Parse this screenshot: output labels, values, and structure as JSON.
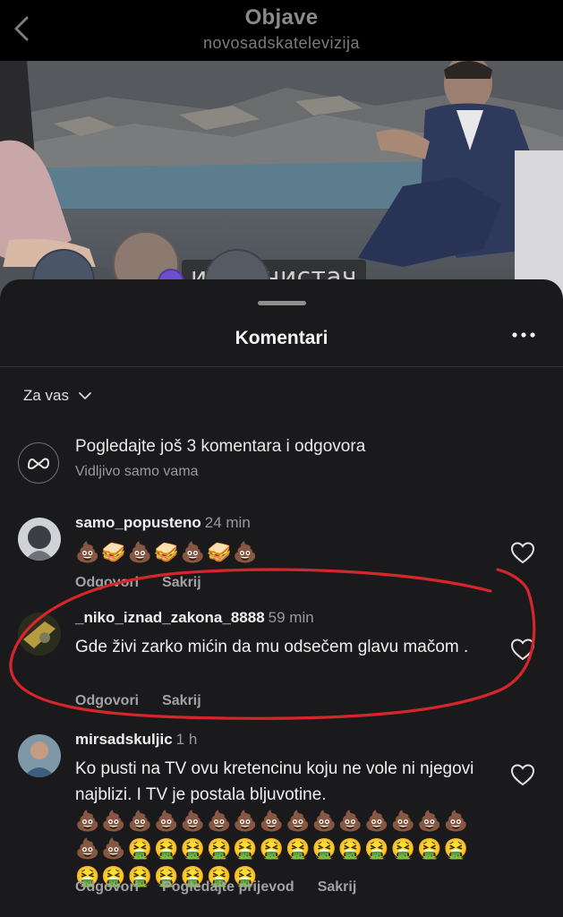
{
  "header": {
    "title": "Objave",
    "subtitle": "novosadskatelevizija"
  },
  "video": {
    "caption": "и пречистач"
  },
  "sheet": {
    "title": "Komentari",
    "filter_label": "Za vas",
    "meta_notice": {
      "title": "Pogledajte još 3 komentara i odgovora",
      "subtitle": "Vidljivo samo vama"
    }
  },
  "comments": [
    {
      "username": "samo_popusteno",
      "time": "24 min",
      "text": "💩🥪💩🥪💩🥪💩",
      "actions": [
        "Odgovori",
        "Sakrij"
      ]
    },
    {
      "username": "_niko_iznad_zakona_8888",
      "time": "59 min",
      "text": "Gde živi zarko mićin da mu odsečem glavu mačom .",
      "actions": [
        "Odgovori",
        "Sakrij"
      ]
    },
    {
      "username": "mirsadskuljic",
      "time": "1 h",
      "text": "Ko pusti na TV ovu kretencinu koju ne vole ni njegovi najblizi. I TV je postala bljuvotine.",
      "emojis": "💩💩💩💩💩💩💩💩💩💩💩💩💩💩💩💩💩🤮🤮🤮🤮🤮🤮🤮🤮🤮🤮🤮🤮🤮🤮🤮🤮🤮🤮🤮🤮",
      "actions": [
        "Odgovori",
        "Pogledajte prijevod",
        "Sakrij"
      ]
    }
  ],
  "icons": {
    "back": "chevron-left-icon",
    "more": "more-horizontal-icon",
    "filter": "chevron-down-icon",
    "meta": "meta-logo-icon",
    "like": "heart-icon"
  },
  "colors": {
    "annotation": "#d7262b",
    "sheet": "#1a1a1c"
  }
}
